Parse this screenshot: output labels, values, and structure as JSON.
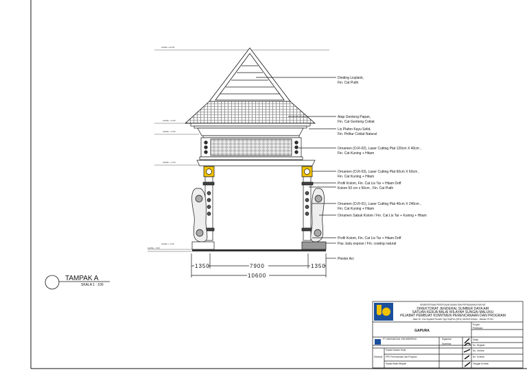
{
  "drawing": {
    "view_title": "TAMPAK A",
    "scale": "SKALA 1 : 100",
    "levels": [
      "LEVEL +10.00",
      "LEVEL + 5.60",
      "LEVEL + 5.00",
      "LEVEL + 4.00",
      "LEVEL + 0.00",
      "LEVEL - 0.30"
    ],
    "dimensions": {
      "left": "1350",
      "middle": "7900",
      "right": "1350",
      "total": "10600"
    },
    "callouts": [
      {
        "line1": "Dinding Lisplank,",
        "line2": "Fin. Cat Putih"
      },
      {
        "line1": "Atap Genteng Papan,",
        "line2": "Fin. Cat Genteng Coklat"
      },
      {
        "line1": "Lis Plafon Kayu Solid,",
        "line2": "Fin. Pelitur Coklat Natural"
      },
      {
        "line1": "Ornamen (O.R-02), Laser Cutting Plat 120cm X 40cm ,",
        "line2": "Fin. Cat Kuning + Hitam"
      },
      {
        "line1": "Ornamen (O.R-03), Laser Cutting Plat 60cm X 60cm ,",
        "line2": "Fin. Cat Kuning + Hitam"
      },
      {
        "line1": "Profil Kolom, Fin. Cat Lis Tar + Hitam Doff",
        "line2": ""
      },
      {
        "line1": "Kolom 50 cm x 50cm , Fin. Cat Putih",
        "line2": ""
      },
      {
        "line1": "Ornamen (O.R-01), Laser Cutting Plat 40cm X 240cm ,",
        "line2": "Fin. Cat Kuning + Hitam"
      },
      {
        "line1": "Ornamen Sabuk Kolom / Fin. Cat Lis Tar + Kuning + Hitam",
        "line2": ""
      },
      {
        "line1": "Profil Kolom, Fin. Cat Lis Tar + Hitam Doff",
        "line2": ""
      },
      {
        "line1": "Pas. batu expose / Fin. coating natural",
        "line2": ""
      },
      {
        "line1": "Plester Aci",
        "line2": ""
      }
    ]
  },
  "title_block": {
    "header": [
      "KEMENTERIAN PEKERJAAN UMUM DAN PERUMAHAN RAKYAT",
      "DIREKTORAT JENDERAL SUMBER DAYA AIR",
      "SATUAN KERJA BALAI WILAYAH SUNGAI MALUKU",
      "PEJABAT PEMBUAT KOMITMEN PERENCANAAN DAN PROGRAM",
      "Jalan Dr. Cris Soplanit Rumah Tiga Telp/Fax (0911) 362615 Ambon - Maluku 97234"
    ],
    "drawing_name": "GAPURA",
    "proyek_label": "Proyek",
    "pekerjaan_label": "Pekerjaan",
    "consultant": "PT. MANUNGGAL ENGINEERING",
    "digambar": "Digambar",
    "diperiksa": "Diperiksa",
    "skala_label": "Skala",
    "no_register": "No. Register",
    "no_lembar": "No. Lembar",
    "no_kontrak": "No. Kontrak",
    "tanggal_kontrak": "Tanggal Kontrak",
    "rows": [
      "Kepala Satuan Kerja",
      "PPK Perencanaan dan Program",
      "Kepala Balai Wilayah"
    ],
    "disetujui": "Disetujui"
  },
  "colors": {
    "accent_yellow": "#f2c200",
    "logo_blue": "#1a4f9c",
    "line": "#111111"
  }
}
